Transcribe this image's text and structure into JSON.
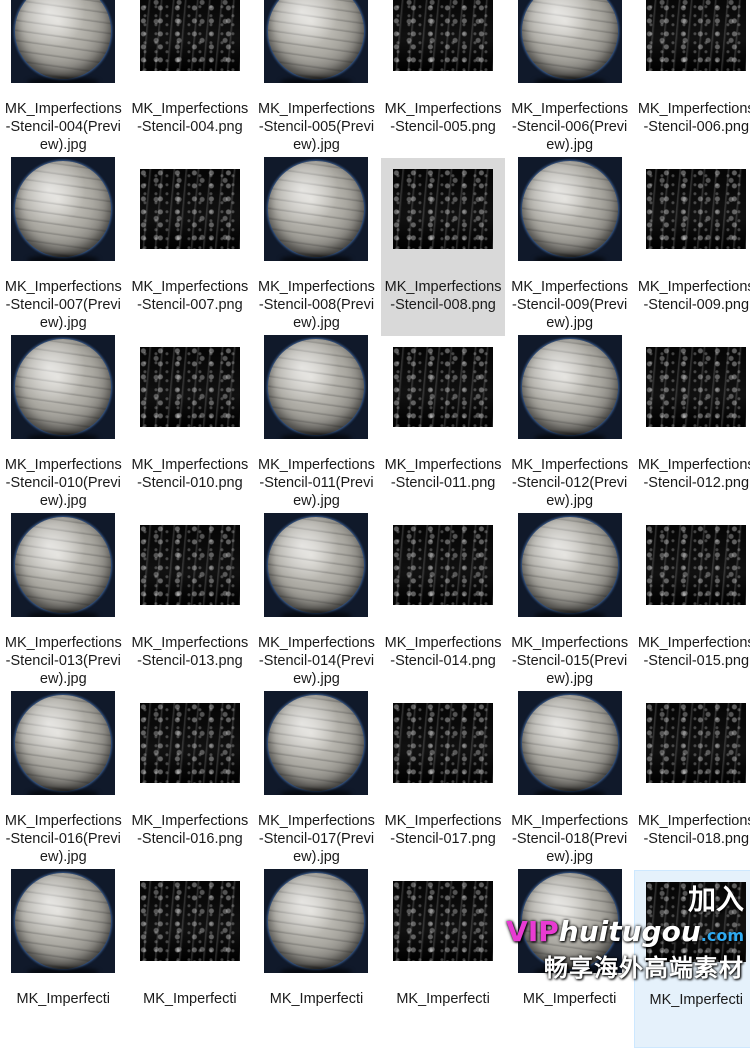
{
  "files": [
    {
      "name": "MK_Imperfections-Stencil-004(Preview).jpg",
      "kind": "preview"
    },
    {
      "name": "MK_Imperfections-Stencil-004.png",
      "kind": "stencil"
    },
    {
      "name": "MK_Imperfections-Stencil-005(Preview).jpg",
      "kind": "preview"
    },
    {
      "name": "MK_Imperfections-Stencil-005.png",
      "kind": "stencil"
    },
    {
      "name": "MK_Imperfections-Stencil-006(Preview).jpg",
      "kind": "preview"
    },
    {
      "name": "MK_Imperfections-Stencil-006.png",
      "kind": "stencil"
    },
    {
      "name": "MK_Imperfections-Stencil-007(Preview).jpg",
      "kind": "preview"
    },
    {
      "name": "MK_Imperfections-Stencil-007.png",
      "kind": "stencil"
    },
    {
      "name": "MK_Imperfections-Stencil-008(Preview).jpg",
      "kind": "preview"
    },
    {
      "name": "MK_Imperfections-Stencil-008.png",
      "kind": "stencil",
      "state": "selected"
    },
    {
      "name": "MK_Imperfections-Stencil-009(Preview).jpg",
      "kind": "preview"
    },
    {
      "name": "MK_Imperfections-Stencil-009.png",
      "kind": "stencil"
    },
    {
      "name": "MK_Imperfections-Stencil-010(Preview).jpg",
      "kind": "preview"
    },
    {
      "name": "MK_Imperfections-Stencil-010.png",
      "kind": "stencil"
    },
    {
      "name": "MK_Imperfections-Stencil-011(Preview).jpg",
      "kind": "preview"
    },
    {
      "name": "MK_Imperfections-Stencil-011.png",
      "kind": "stencil"
    },
    {
      "name": "MK_Imperfections-Stencil-012(Preview).jpg",
      "kind": "preview"
    },
    {
      "name": "MK_Imperfections-Stencil-012.png",
      "kind": "stencil"
    },
    {
      "name": "MK_Imperfections-Stencil-013(Preview).jpg",
      "kind": "preview"
    },
    {
      "name": "MK_Imperfections-Stencil-013.png",
      "kind": "stencil"
    },
    {
      "name": "MK_Imperfections-Stencil-014(Preview).jpg",
      "kind": "preview"
    },
    {
      "name": "MK_Imperfections-Stencil-014.png",
      "kind": "stencil"
    },
    {
      "name": "MK_Imperfections-Stencil-015(Preview).jpg",
      "kind": "preview"
    },
    {
      "name": "MK_Imperfections-Stencil-015.png",
      "kind": "stencil"
    },
    {
      "name": "MK_Imperfections-Stencil-016(Preview).jpg",
      "kind": "preview"
    },
    {
      "name": "MK_Imperfections-Stencil-016.png",
      "kind": "stencil"
    },
    {
      "name": "MK_Imperfections-Stencil-017(Preview).jpg",
      "kind": "preview"
    },
    {
      "name": "MK_Imperfections-Stencil-017.png",
      "kind": "stencil"
    },
    {
      "name": "MK_Imperfections-Stencil-018(Preview).jpg",
      "kind": "preview"
    },
    {
      "name": "MK_Imperfections-Stencil-018.png",
      "kind": "stencil"
    },
    {
      "name": "MK_Imperfecti",
      "kind": "preview"
    },
    {
      "name": "MK_Imperfecti",
      "kind": "stencil"
    },
    {
      "name": "MK_Imperfecti",
      "kind": "preview"
    },
    {
      "name": "MK_Imperfecti",
      "kind": "stencil"
    },
    {
      "name": "MK_Imperfecti",
      "kind": "preview"
    },
    {
      "name": "MK_Imperfecti",
      "kind": "stencil",
      "state": "hovered"
    }
  ],
  "watermark": {
    "line1_prefix": "加入",
    "line1_vip": "VIP",
    "line1_brand": "huitugou",
    "line1_com": ".com",
    "line2": "畅享海外高端素材"
  },
  "colors": {
    "selected": "#d9d9d9",
    "hovered": "#e5f1fb",
    "vip": "#e83bd2",
    "com": "#2fa9f0"
  }
}
